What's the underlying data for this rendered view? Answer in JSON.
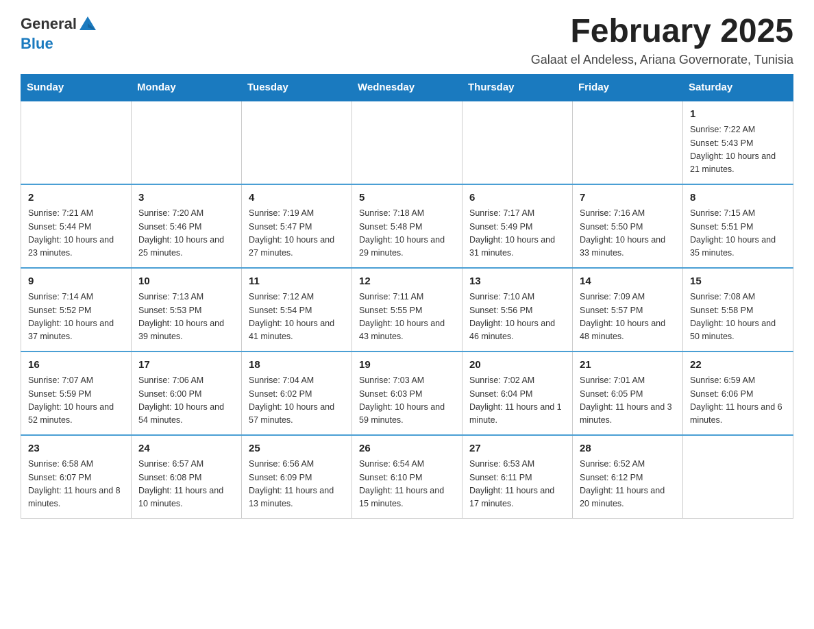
{
  "header": {
    "logo_general": "General",
    "logo_blue": "Blue",
    "title": "February 2025",
    "subtitle": "Galaat el Andeless, Ariana Governorate, Tunisia"
  },
  "calendar": {
    "days_of_week": [
      "Sunday",
      "Monday",
      "Tuesday",
      "Wednesday",
      "Thursday",
      "Friday",
      "Saturday"
    ],
    "weeks": [
      [
        {
          "day": "",
          "info": ""
        },
        {
          "day": "",
          "info": ""
        },
        {
          "day": "",
          "info": ""
        },
        {
          "day": "",
          "info": ""
        },
        {
          "day": "",
          "info": ""
        },
        {
          "day": "",
          "info": ""
        },
        {
          "day": "1",
          "info": "Sunrise: 7:22 AM\nSunset: 5:43 PM\nDaylight: 10 hours and 21 minutes."
        }
      ],
      [
        {
          "day": "2",
          "info": "Sunrise: 7:21 AM\nSunset: 5:44 PM\nDaylight: 10 hours and 23 minutes."
        },
        {
          "day": "3",
          "info": "Sunrise: 7:20 AM\nSunset: 5:46 PM\nDaylight: 10 hours and 25 minutes."
        },
        {
          "day": "4",
          "info": "Sunrise: 7:19 AM\nSunset: 5:47 PM\nDaylight: 10 hours and 27 minutes."
        },
        {
          "day": "5",
          "info": "Sunrise: 7:18 AM\nSunset: 5:48 PM\nDaylight: 10 hours and 29 minutes."
        },
        {
          "day": "6",
          "info": "Sunrise: 7:17 AM\nSunset: 5:49 PM\nDaylight: 10 hours and 31 minutes."
        },
        {
          "day": "7",
          "info": "Sunrise: 7:16 AM\nSunset: 5:50 PM\nDaylight: 10 hours and 33 minutes."
        },
        {
          "day": "8",
          "info": "Sunrise: 7:15 AM\nSunset: 5:51 PM\nDaylight: 10 hours and 35 minutes."
        }
      ],
      [
        {
          "day": "9",
          "info": "Sunrise: 7:14 AM\nSunset: 5:52 PM\nDaylight: 10 hours and 37 minutes."
        },
        {
          "day": "10",
          "info": "Sunrise: 7:13 AM\nSunset: 5:53 PM\nDaylight: 10 hours and 39 minutes."
        },
        {
          "day": "11",
          "info": "Sunrise: 7:12 AM\nSunset: 5:54 PM\nDaylight: 10 hours and 41 minutes."
        },
        {
          "day": "12",
          "info": "Sunrise: 7:11 AM\nSunset: 5:55 PM\nDaylight: 10 hours and 43 minutes."
        },
        {
          "day": "13",
          "info": "Sunrise: 7:10 AM\nSunset: 5:56 PM\nDaylight: 10 hours and 46 minutes."
        },
        {
          "day": "14",
          "info": "Sunrise: 7:09 AM\nSunset: 5:57 PM\nDaylight: 10 hours and 48 minutes."
        },
        {
          "day": "15",
          "info": "Sunrise: 7:08 AM\nSunset: 5:58 PM\nDaylight: 10 hours and 50 minutes."
        }
      ],
      [
        {
          "day": "16",
          "info": "Sunrise: 7:07 AM\nSunset: 5:59 PM\nDaylight: 10 hours and 52 minutes."
        },
        {
          "day": "17",
          "info": "Sunrise: 7:06 AM\nSunset: 6:00 PM\nDaylight: 10 hours and 54 minutes."
        },
        {
          "day": "18",
          "info": "Sunrise: 7:04 AM\nSunset: 6:02 PM\nDaylight: 10 hours and 57 minutes."
        },
        {
          "day": "19",
          "info": "Sunrise: 7:03 AM\nSunset: 6:03 PM\nDaylight: 10 hours and 59 minutes."
        },
        {
          "day": "20",
          "info": "Sunrise: 7:02 AM\nSunset: 6:04 PM\nDaylight: 11 hours and 1 minute."
        },
        {
          "day": "21",
          "info": "Sunrise: 7:01 AM\nSunset: 6:05 PM\nDaylight: 11 hours and 3 minutes."
        },
        {
          "day": "22",
          "info": "Sunrise: 6:59 AM\nSunset: 6:06 PM\nDaylight: 11 hours and 6 minutes."
        }
      ],
      [
        {
          "day": "23",
          "info": "Sunrise: 6:58 AM\nSunset: 6:07 PM\nDaylight: 11 hours and 8 minutes."
        },
        {
          "day": "24",
          "info": "Sunrise: 6:57 AM\nSunset: 6:08 PM\nDaylight: 11 hours and 10 minutes."
        },
        {
          "day": "25",
          "info": "Sunrise: 6:56 AM\nSunset: 6:09 PM\nDaylight: 11 hours and 13 minutes."
        },
        {
          "day": "26",
          "info": "Sunrise: 6:54 AM\nSunset: 6:10 PM\nDaylight: 11 hours and 15 minutes."
        },
        {
          "day": "27",
          "info": "Sunrise: 6:53 AM\nSunset: 6:11 PM\nDaylight: 11 hours and 17 minutes."
        },
        {
          "day": "28",
          "info": "Sunrise: 6:52 AM\nSunset: 6:12 PM\nDaylight: 11 hours and 20 minutes."
        },
        {
          "day": "",
          "info": ""
        }
      ]
    ]
  }
}
